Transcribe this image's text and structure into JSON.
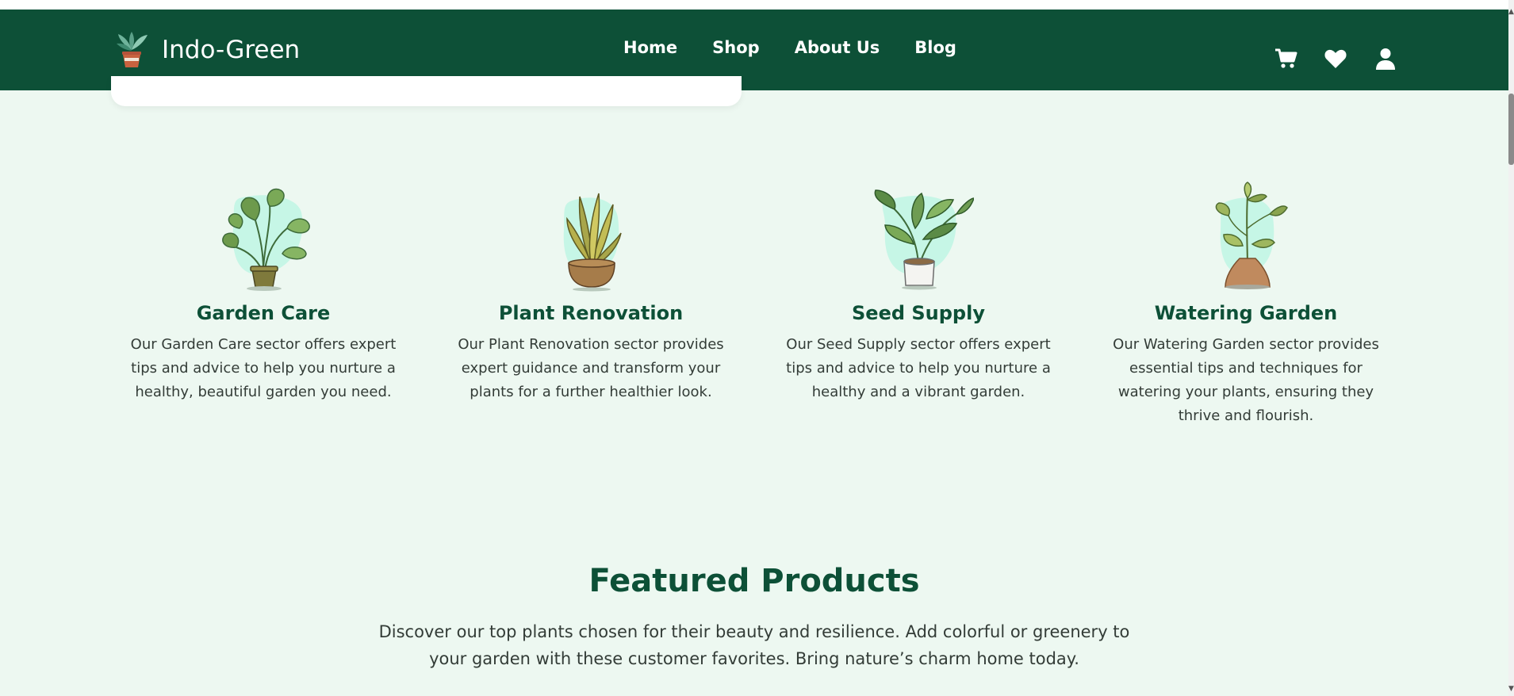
{
  "brand": {
    "name": "Indo-Green",
    "logo_icon": "potted-plant-logo-icon"
  },
  "nav": {
    "items": [
      {
        "label": "Home"
      },
      {
        "label": "Shop"
      },
      {
        "label": "About Us"
      },
      {
        "label": "Blog"
      }
    ],
    "icons": [
      "cart-icon",
      "heart-icon",
      "user-icon"
    ]
  },
  "services": [
    {
      "title": "Garden Care",
      "text": "Our Garden Care sector offers expert tips and advice to help you nurture a healthy, beautiful garden you need.",
      "icon": "monstera-plant-icon"
    },
    {
      "title": "Plant Renovation",
      "text": "Our Plant Renovation sector provides expert guidance and transform your plants for a further healthier look.",
      "icon": "snake-plant-icon"
    },
    {
      "title": "Seed Supply",
      "text": "Our Seed Supply sector offers expert tips and advice to help you nurture a healthy and a vibrant garden.",
      "icon": "leafy-plant-white-pot-icon"
    },
    {
      "title": "Watering Garden",
      "text": "Our Watering Garden sector provides essential tips and techniques for watering your plants, ensuring they thrive and flourish.",
      "icon": "sapling-clay-pot-icon"
    }
  ],
  "featured": {
    "title": "Featured Products",
    "text": "Discover our top plants chosen for their beauty and resilience. Add colorful or greenery to your garden with these customer favorites. Bring nature’s charm home today."
  },
  "colors": {
    "nav_bg": "#0d5037",
    "page_bg": "#edf8f1",
    "heading": "#0d5037",
    "body_text": "#333c37"
  }
}
